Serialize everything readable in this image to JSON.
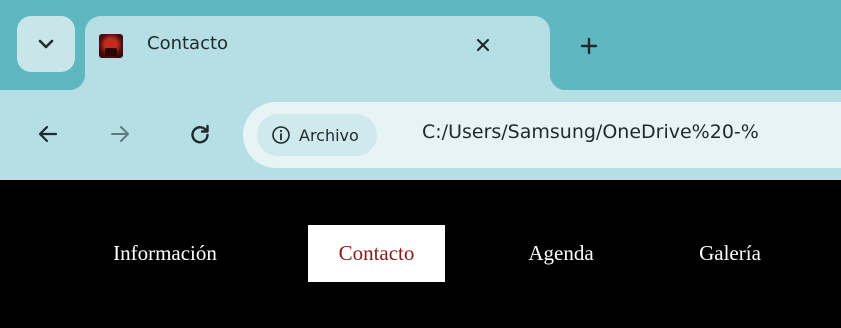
{
  "browser": {
    "tab": {
      "title": "Contacto",
      "favicon": "site-favicon"
    },
    "icons": {
      "tab_search": "chevron-down-icon",
      "close": "close-icon",
      "new_tab": "plus-icon",
      "back": "arrow-left-icon",
      "forward": "arrow-right-icon",
      "reload": "reload-icon",
      "info": "info-icon"
    },
    "address_bar": {
      "chip_label": "Archivo",
      "url": "C:/Users/Samsung/OneDrive%20-%"
    },
    "colors": {
      "tabstrip": "#5fb7c0",
      "active_tab": "#b5dfe4",
      "omnibox": "#e6f4f6"
    }
  },
  "page": {
    "nav": [
      {
        "label": "Información",
        "active": false
      },
      {
        "label": "Contacto",
        "active": true
      },
      {
        "label": "Agenda",
        "active": false
      },
      {
        "label": "Galería",
        "active": false
      }
    ],
    "colors": {
      "background": "#000000",
      "link": "#ffffff",
      "active_bg": "#ffffff",
      "active_text": "#8b1a1a"
    }
  }
}
